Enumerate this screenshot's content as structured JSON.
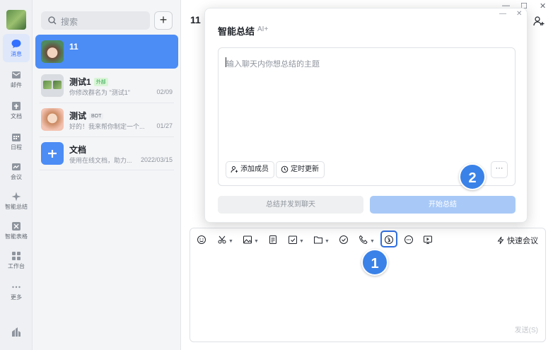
{
  "nav": {
    "items": [
      {
        "label": "消息",
        "icon": "message-icon"
      },
      {
        "label": "邮件",
        "icon": "mail-icon"
      },
      {
        "label": "文档",
        "icon": "doc-icon"
      },
      {
        "label": "日程",
        "icon": "calendar-icon"
      },
      {
        "label": "会议",
        "icon": "meeting-icon"
      },
      {
        "label": "智能总结",
        "icon": "sparkle-icon"
      },
      {
        "label": "智能表格",
        "icon": "smart-table-icon"
      },
      {
        "label": "工作台",
        "icon": "grid-icon"
      },
      {
        "label": "更多",
        "icon": "more-icon"
      }
    ]
  },
  "search": {
    "placeholder": "搜索"
  },
  "conversations": [
    {
      "title": "11",
      "subtitle": "",
      "time": "",
      "tag": ""
    },
    {
      "title": "测试1",
      "tag": "外部",
      "subtitle": "你修改群名为 \"测试1\"",
      "time": "02/09"
    },
    {
      "title": "测试",
      "tag": "BOT",
      "subtitle": "好的！我来帮你制定一个...",
      "time": "01/27"
    },
    {
      "title": "文档",
      "tag": "",
      "subtitle": "使用在线文档，助力...",
      "time": "2022/03/15"
    }
  ],
  "chat": {
    "title": "11",
    "quick_meeting": "快速会议",
    "send": "发送(S)"
  },
  "dialog": {
    "title": "智能总结",
    "ai_badge": "AI+",
    "placeholder": "输入聊天内你想总结的主题",
    "add_member": "添加成员",
    "scheduled_update": "定时更新",
    "more": "···",
    "summarize_send": "总结并发到聊天",
    "start_summary": "开始总结"
  },
  "markers": {
    "one": "1",
    "two": "2"
  },
  "colors": {
    "accent": "#3370ff",
    "active_conv": "#4c8cf5",
    "marker": "#3a82e8"
  }
}
